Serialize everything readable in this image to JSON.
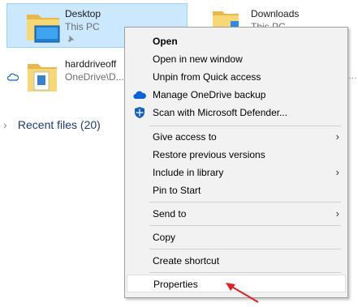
{
  "tiles": [
    {
      "title": "Desktop",
      "subtitle": "This PC",
      "pin_icon": "pin-icon",
      "selected": true
    },
    {
      "title": "Downloads",
      "subtitle": "This PC"
    },
    {
      "title": "harddriveoff",
      "subtitle": "OneDrive\\D..."
    }
  ],
  "recent": {
    "label": "Recent files (20)"
  },
  "context_menu": {
    "items": [
      {
        "label": "Open",
        "bold": true
      },
      {
        "label": "Open in new window"
      },
      {
        "label": "Unpin from Quick access"
      },
      {
        "label": "Manage OneDrive backup",
        "icon": "onedrive-icon"
      },
      {
        "label": "Scan with Microsoft Defender...",
        "icon": "defender-icon"
      },
      {
        "label": "Give access to",
        "submenu": true
      },
      {
        "label": "Restore previous versions"
      },
      {
        "label": "Include in library",
        "submenu": true
      },
      {
        "label": "Pin to Start"
      },
      {
        "label": "Send to",
        "submenu": true
      },
      {
        "label": "Copy"
      },
      {
        "label": "Create shortcut"
      },
      {
        "label": "Properties",
        "highlighted": true
      }
    ]
  },
  "colors": {
    "selection_bg": "#cce8ff",
    "selection_border": "#99d1ff",
    "menu_bg": "#f2f2f2",
    "annotation_arrow": "#e02020",
    "onedrive_blue": "#0a64d8"
  }
}
